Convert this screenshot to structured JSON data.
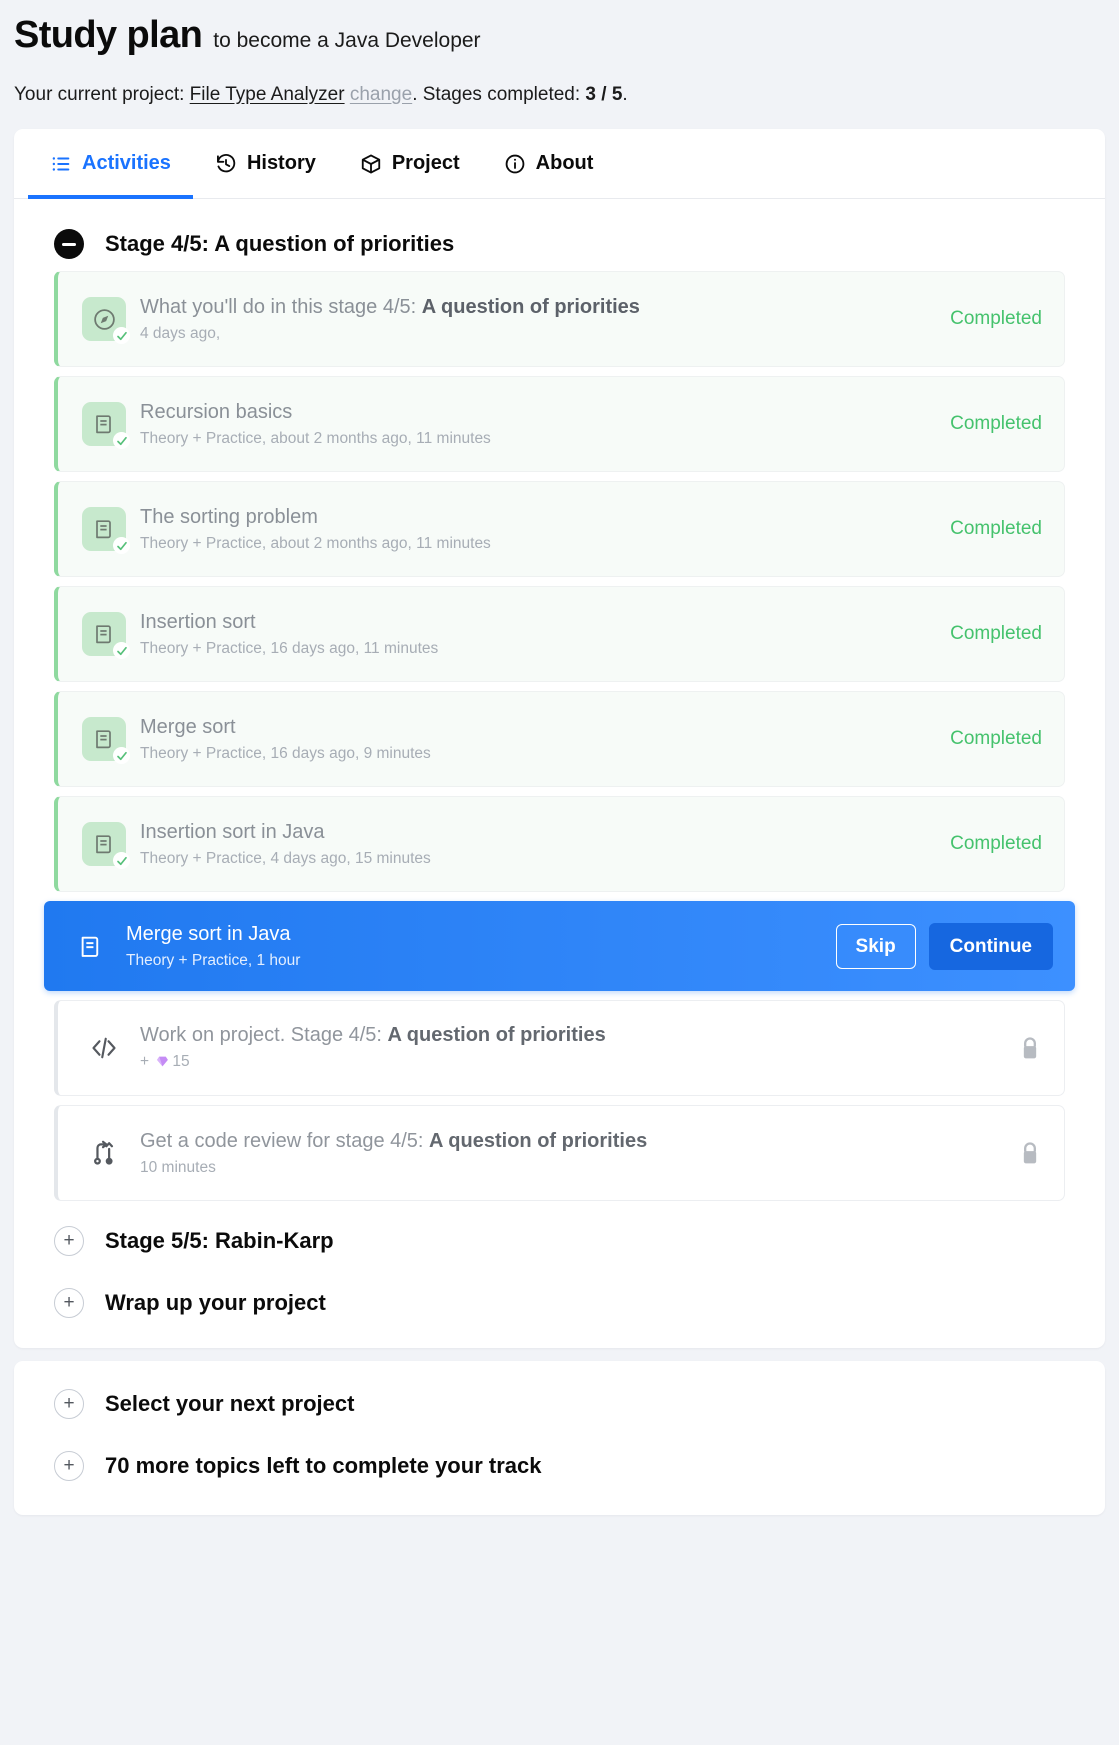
{
  "header": {
    "title_main": "Study plan",
    "title_sub": "to become a Java Developer",
    "sub_prefix": "Your current project: ",
    "project_name": "File Type Analyzer",
    "change_label": "change",
    "sub_middle": ". Stages completed: ",
    "stages_completed": "3 / 5",
    "sub_suffix": "."
  },
  "tabs": [
    {
      "label": "Activities",
      "icon": "list-icon",
      "active": true
    },
    {
      "label": "History",
      "icon": "history-icon",
      "active": false
    },
    {
      "label": "Project",
      "icon": "cube-icon",
      "active": false
    },
    {
      "label": "About",
      "icon": "info-icon",
      "active": false
    }
  ],
  "stage": {
    "title": "Stage 4/5: A question of priorities",
    "toggle": "minus"
  },
  "activities": [
    {
      "title_plain": "What you'll do in this stage 4/5: ",
      "title_bold": "A question of priorities",
      "sub": "4 days ago,",
      "status": "Completed",
      "icon": "compass-icon",
      "state": "completed"
    },
    {
      "title_plain": "Recursion basics",
      "title_bold": "",
      "sub": "Theory + Practice, about 2 months ago, 11 minutes",
      "status": "Completed",
      "icon": "book-icon",
      "state": "completed"
    },
    {
      "title_plain": "The sorting problem",
      "title_bold": "",
      "sub": "Theory + Practice, about 2 months ago, 11 minutes",
      "status": "Completed",
      "icon": "book-icon",
      "state": "completed"
    },
    {
      "title_plain": "Insertion sort",
      "title_bold": "",
      "sub": "Theory + Practice, 16 days ago, 11 minutes",
      "status": "Completed",
      "icon": "book-icon",
      "state": "completed"
    },
    {
      "title_plain": "Merge sort",
      "title_bold": "",
      "sub": "Theory + Practice, 16 days ago, 9 minutes",
      "status": "Completed",
      "icon": "book-icon",
      "state": "completed"
    },
    {
      "title_plain": "Insertion sort in Java",
      "title_bold": "",
      "sub": "Theory + Practice, 4 days ago, 15 minutes",
      "status": "Completed",
      "icon": "book-icon",
      "state": "completed"
    }
  ],
  "current_activity": {
    "title": "Merge sort in Java",
    "sub": "Theory + Practice, 1 hour",
    "icon": "book-icon",
    "skip_label": "Skip",
    "continue_label": "Continue"
  },
  "locked_activities": [
    {
      "title_plain": "Work on project. Stage 4/5: ",
      "title_bold": "A question of priorities",
      "sub_prefix": "+ ",
      "sub_gem": "gem-icon",
      "sub_value": "15",
      "sub": "",
      "icon": "code-icon",
      "lock": "lock-icon"
    },
    {
      "title_plain": "Get a code review for stage 4/5: ",
      "title_bold": "A question of priorities",
      "sub": "10 minutes",
      "icon": "branch-icon",
      "lock": "lock-icon"
    }
  ],
  "collapsed_stages": [
    {
      "label": "Stage 5/5: Rabin-Karp",
      "toggle": "plus"
    },
    {
      "label": "Wrap up your project",
      "toggle": "plus"
    }
  ],
  "footer_sections": [
    {
      "label": "Select your next project",
      "toggle": "plus"
    },
    {
      "label": "70 more topics left to complete your track",
      "toggle": "plus"
    }
  ],
  "colors": {
    "accent": "#1a73ff",
    "current_row": "#2079f0",
    "completed_green": "#45c26d",
    "badge_green": "#c7e9cd",
    "gem_purple": "#b980f0",
    "page_bg": "#f1f3f7"
  }
}
